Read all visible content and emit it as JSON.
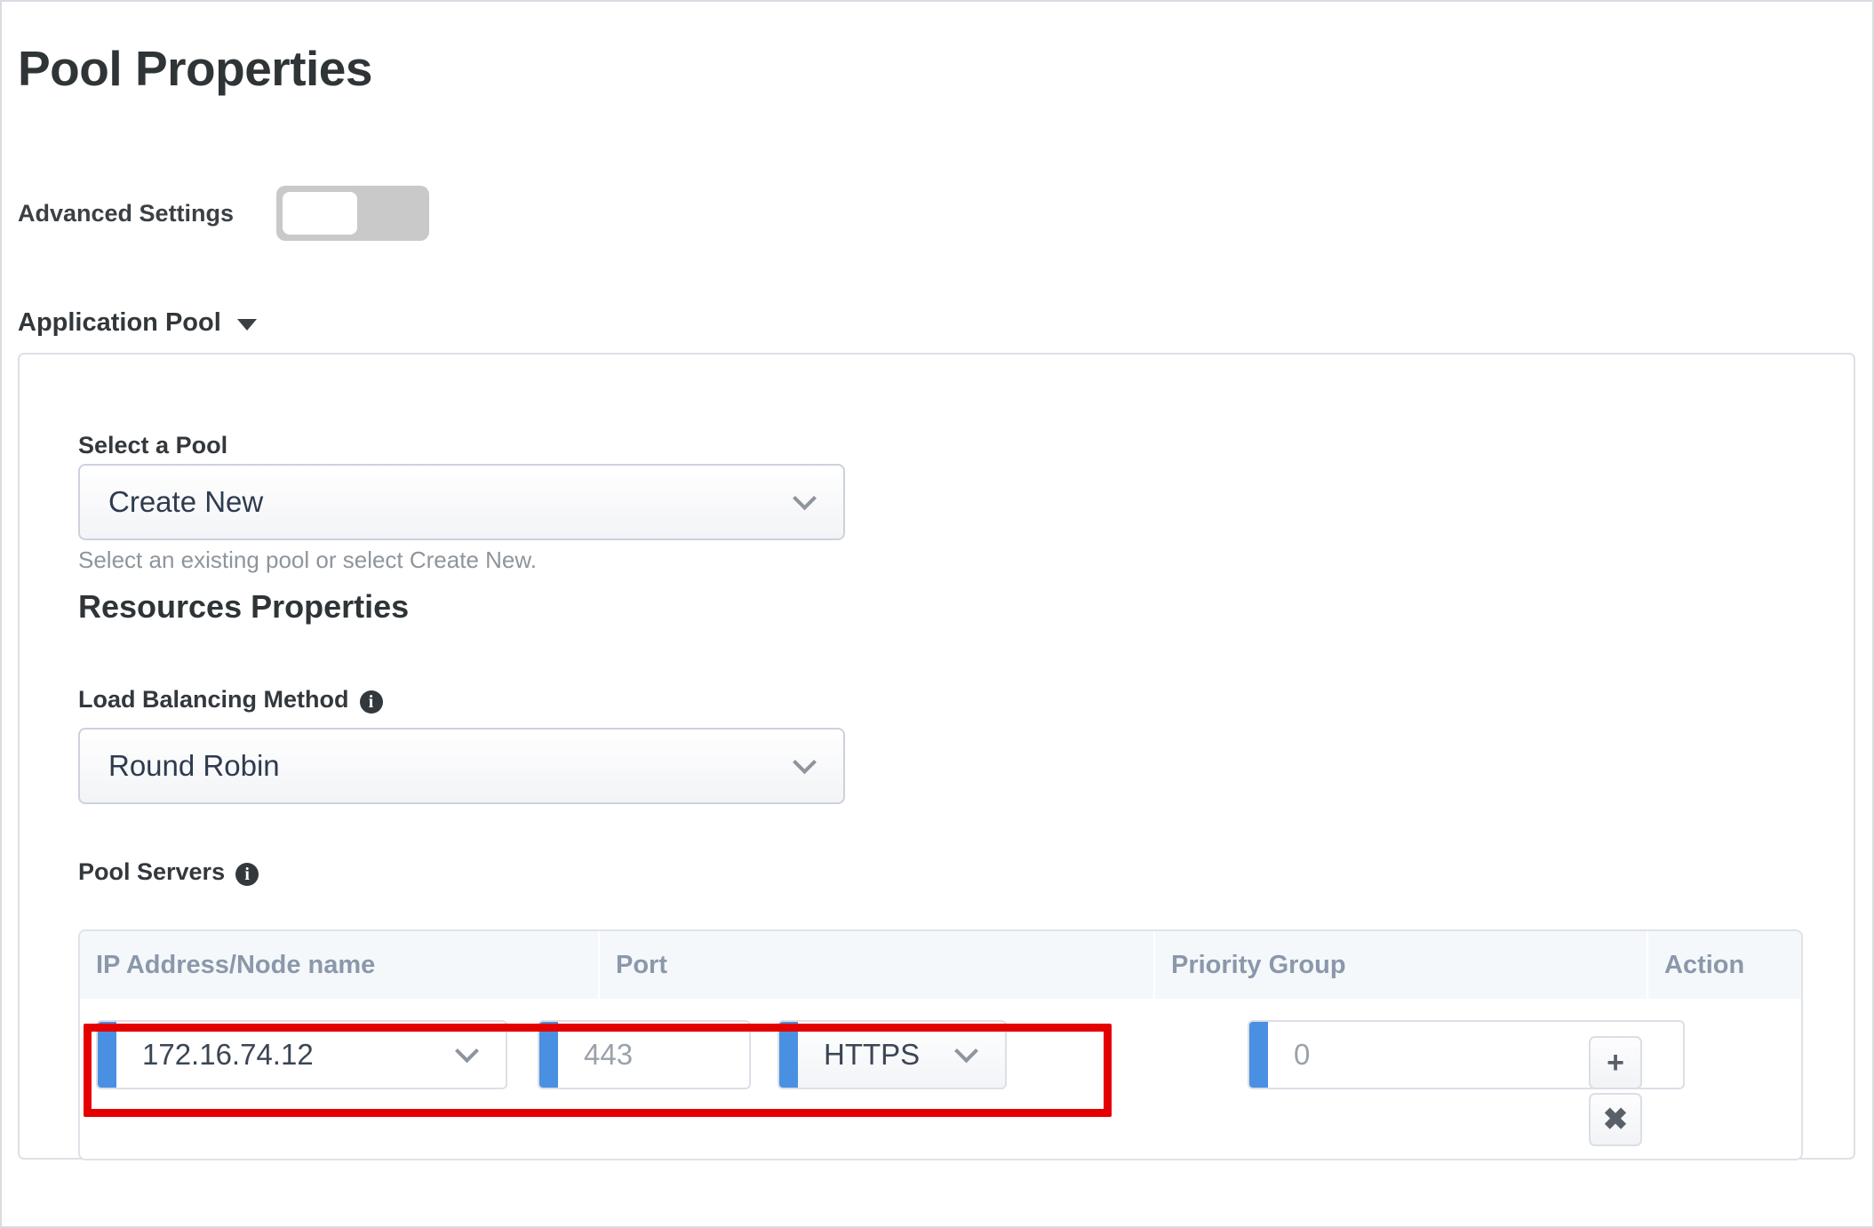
{
  "page": {
    "title": "Pool Properties"
  },
  "advanced": {
    "label": "Advanced Settings",
    "state": "off"
  },
  "application_pool": {
    "heading": "Application Pool",
    "caret": "chevron-down-icon"
  },
  "select_pool": {
    "label": "Select a Pool",
    "value": "Create New",
    "help": "Select an existing pool or select Create New."
  },
  "resources": {
    "heading": "Resources Properties"
  },
  "load_balancing": {
    "label": "Load Balancing Method",
    "info": "info-icon",
    "value": "Round Robin"
  },
  "pool_servers": {
    "label": "Pool Servers",
    "info": "info-icon",
    "columns": [
      "IP Address/Node name",
      "Port",
      "Priority Group",
      "Action"
    ],
    "rows": [
      {
        "ip": "172.16.74.12",
        "port": "443",
        "protocol": "HTTPS",
        "priority_group": "0",
        "add_label": "+",
        "remove_label": "✖"
      }
    ]
  },
  "annotation": {
    "highlight_color": "#e50000",
    "accent_color": "#4a90e2"
  }
}
